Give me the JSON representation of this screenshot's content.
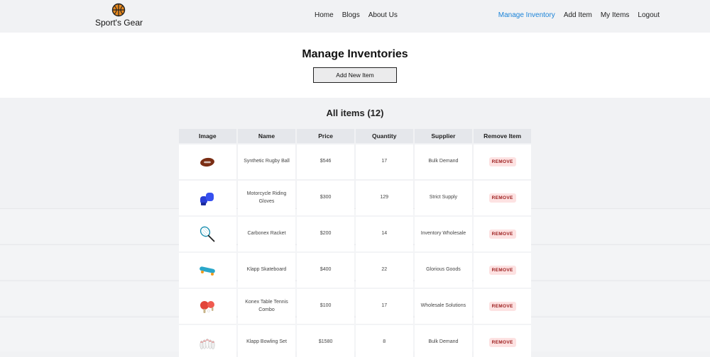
{
  "brand": {
    "name": "Sport's Gear",
    "logo_icon": "basketball-icon"
  },
  "nav": {
    "center": [
      {
        "label": "Home"
      },
      {
        "label": "Blogs"
      },
      {
        "label": "About Us"
      }
    ],
    "right": [
      {
        "label": "Manage Inventory",
        "active": true
      },
      {
        "label": "Add Item"
      },
      {
        "label": "My Items"
      },
      {
        "label": "Logout"
      }
    ]
  },
  "hero": {
    "title": "Manage Inventories",
    "add_button_label": "Add New Item"
  },
  "items_heading": "All items (12)",
  "table": {
    "headers": [
      "Image",
      "Name",
      "Price",
      "Quantity",
      "Supplier",
      "Remove Item"
    ],
    "remove_label": "REMOVE",
    "rows": [
      {
        "image_icon": "rugby-ball-icon",
        "name": "Synthetic Rugby Ball",
        "price": "$546",
        "quantity": "17",
        "supplier": "Bulk Demand"
      },
      {
        "image_icon": "boxing-gloves-icon",
        "name": "Motorcycle Riding Gloves",
        "price": "$300",
        "quantity": "129",
        "supplier": "Strict Supply"
      },
      {
        "image_icon": "tennis-racket-icon",
        "name": "Carbonex Racket",
        "price": "$200",
        "quantity": "14",
        "supplier": "Inventory Wholesale"
      },
      {
        "image_icon": "skateboard-icon",
        "name": "Klapp Skateboard",
        "price": "$400",
        "quantity": "22",
        "supplier": "Glorious Goods"
      },
      {
        "image_icon": "table-tennis-icon",
        "name": "Konex Table Tennis Combo",
        "price": "$100",
        "quantity": "17",
        "supplier": "Wholesale Solutions"
      },
      {
        "image_icon": "bowling-set-icon",
        "name": "Klapp Bowling Set",
        "price": "$1580",
        "quantity": "8",
        "supplier": "Bulk Demand"
      }
    ]
  },
  "colors": {
    "accent": "#1a83d8",
    "remove_bg": "#fde2e2",
    "remove_text": "#9b1c1c",
    "page_bg": "#f1f2f4"
  }
}
